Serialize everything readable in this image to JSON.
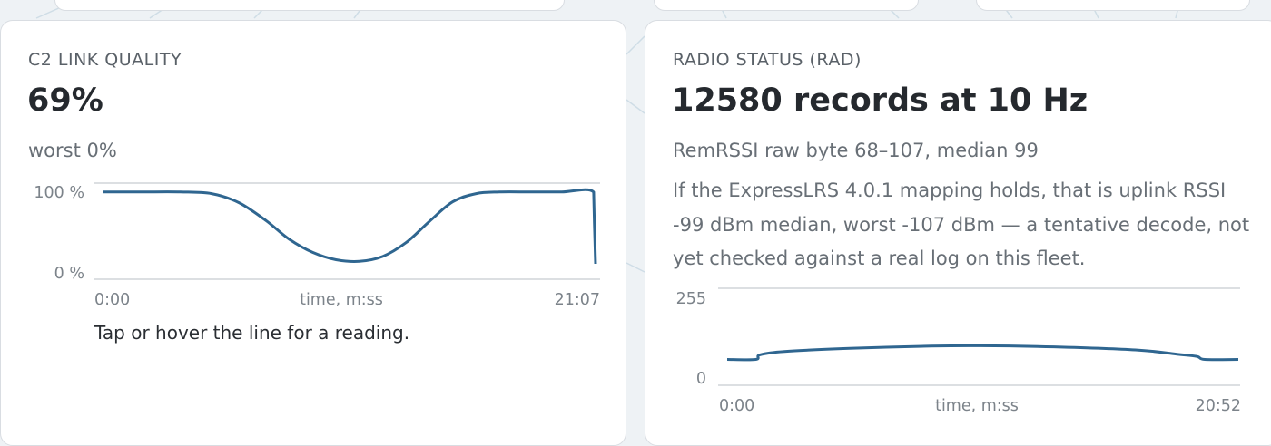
{
  "theme": {
    "line_color": "#2f6690",
    "grid_color": "#c8ccd0",
    "card_bg": "#ffffff",
    "page_bg": "#eef2f5"
  },
  "link_card": {
    "title": "C2 LINK QUALITY",
    "value": "69%",
    "sub": "worst 0%",
    "hint": "Tap or hover the line for a reading.",
    "chart_data": {
      "type": "line",
      "ylabel_ticks": [
        "100 %",
        "0 %"
      ],
      "x_tick_start": "0:00",
      "x_tick_end": "21:07",
      "xlabel": "time, m:ss",
      "ylim": [
        0,
        100
      ],
      "x_unit": "seconds",
      "xlim": [
        0,
        1267
      ],
      "series": [
        {
          "x": [
            0,
            100,
            200,
            280,
            350,
            420,
            480,
            540,
            600,
            660,
            720,
            780,
            840,
            900,
            960,
            1020,
            1100,
            1180,
            1262,
            1264,
            1267
          ],
          "y": [
            98,
            98,
            98,
            96,
            85,
            63,
            40,
            24,
            15,
            13,
            19,
            36,
            62,
            86,
            96,
            98,
            98,
            98,
            98,
            60,
            10
          ]
        }
      ]
    }
  },
  "radio_card": {
    "title": "RADIO STATUS (RAD)",
    "value": "12580 records at 10 Hz",
    "sub": "RemRSSI raw byte 68–107, median 99",
    "note": "If the ExpressLRS 4.0.1 mapping holds, that is uplink RSSI -99 dBm median, worst -107 dBm — a tentative decode, not yet checked against a real log on this fleet.",
    "chart_data": {
      "type": "line",
      "ylabel_ticks": [
        "255",
        "0"
      ],
      "x_tick_start": "0:00",
      "x_tick_end": "20:52",
      "xlabel": "time, m:ss",
      "ylim": [
        0,
        255
      ],
      "x_unit": "seconds",
      "xlim": [
        0,
        1252
      ],
      "series": [
        {
          "x": [
            0,
            70,
            80,
            140,
            300,
            500,
            620,
            800,
            1000,
            1100,
            1150,
            1170,
            1252
          ],
          "y": [
            68,
            68,
            80,
            89,
            97,
            103,
            104,
            101,
            93,
            82,
            76,
            68,
            68
          ]
        }
      ]
    }
  }
}
